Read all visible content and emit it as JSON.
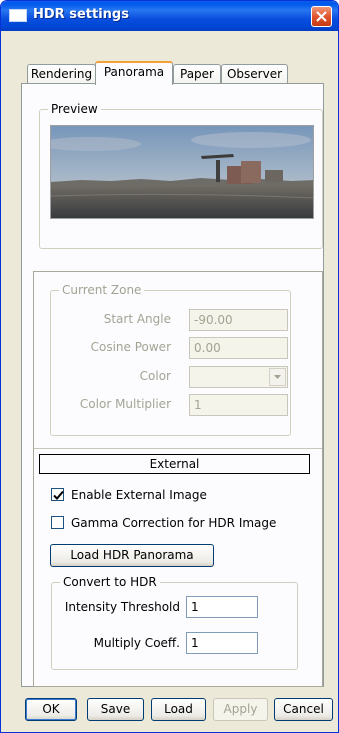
{
  "window": {
    "title": "HDR settings",
    "icon": "window-icon",
    "close_icon": "close-icon"
  },
  "tabs": [
    {
      "label": "Rendering",
      "active": false
    },
    {
      "label": "Panorama",
      "active": true
    },
    {
      "label": "Paper",
      "active": false
    },
    {
      "label": "Observer",
      "active": false
    }
  ],
  "preview": {
    "legend": "Preview"
  },
  "current_zone": {
    "legend": "Current Zone",
    "start_angle_label": "Start Angle",
    "start_angle_value": "-90.00",
    "cosine_power_label": "Cosine Power",
    "cosine_power_value": "0.00",
    "color_label": "Color",
    "color_value": "",
    "color_multiplier_label": "Color Multiplier",
    "color_multiplier_value": "1"
  },
  "external": {
    "section_label": "External",
    "enable_external_label": "Enable External Image",
    "enable_external_checked": true,
    "gamma_label": "Gamma Correction for HDR Image",
    "gamma_checked": false,
    "load_button_label": "Load HDR Panorama"
  },
  "convert": {
    "legend": "Convert to HDR",
    "intensity_label": "Intensity Threshold",
    "intensity_value": "1",
    "multiply_label": "Multiply Coeff.",
    "multiply_value": "1"
  },
  "buttons": {
    "ok": "OK",
    "save": "Save",
    "load": "Load",
    "apply": "Apply",
    "cancel": "Cancel"
  },
  "colors": {
    "titlebar": "#0054e3",
    "dialog_bg": "#ece9d8",
    "panel_bg": "#fcfcfe",
    "tab_highlight": "#f2a139",
    "close_button": "#e0562f"
  }
}
